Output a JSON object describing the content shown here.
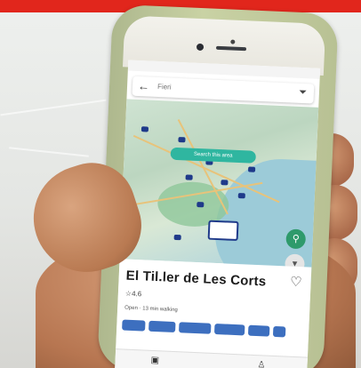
{
  "banner": {
    "color": "#e1261c"
  },
  "phone": {
    "status": {
      "carrier": "",
      "time": "",
      "battery": ""
    },
    "search": {
      "placeholder": "Fieri",
      "back_icon": "arrow-left-icon",
      "filter_icon": "filter-icon"
    },
    "map": {
      "search_area_label": "Search this area",
      "location_icon": "location-pin-icon",
      "navigation_icon": "navigation-icon"
    },
    "place": {
      "title": "El Til.ler de Les Corts",
      "rating": "☆4.6",
      "hours": "Open · 13 min walking",
      "favorite_icon": "heart-icon"
    },
    "bottom_nav": {
      "left_icon": "map-icon",
      "right_icon": "person-icon"
    }
  }
}
